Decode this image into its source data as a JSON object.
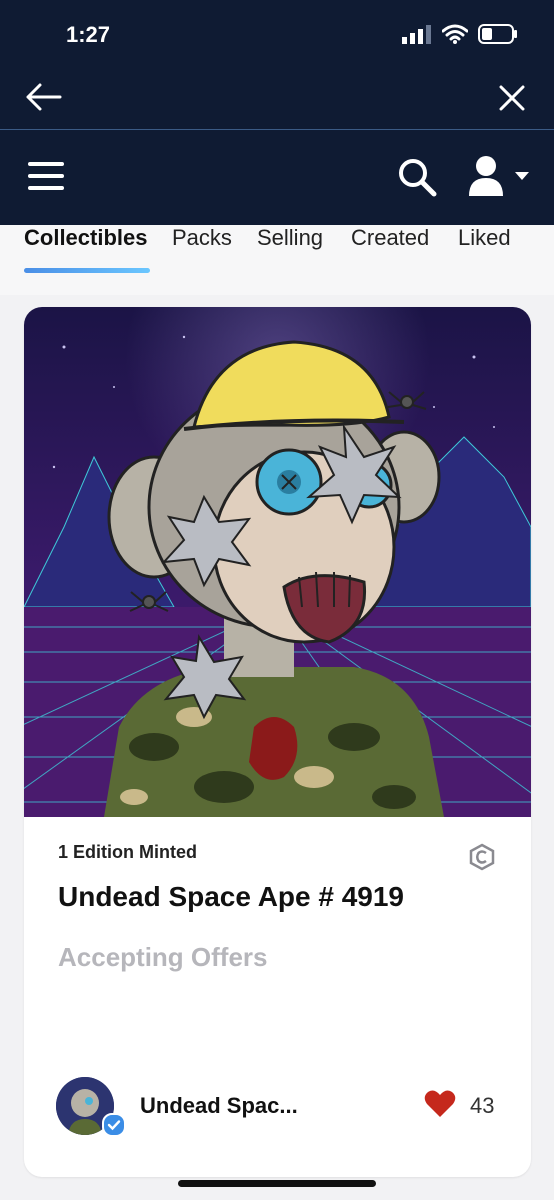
{
  "status": {
    "time": "1:27"
  },
  "tabs": [
    "Collectibles",
    "Packs",
    "Selling",
    "Created",
    "Liked"
  ],
  "card": {
    "edition_text": "1 Edition Minted",
    "title": "Undead Space Ape # 4919",
    "status_text": "Accepting Offers",
    "creator_name": "Undead Spac...",
    "likes_count": "43"
  },
  "icons": [
    "back-arrow-icon",
    "close-icon",
    "menu-icon",
    "search-icon",
    "user-icon",
    "chevron-down-icon",
    "copyright-badge-icon",
    "heart-icon",
    "verified-icon"
  ],
  "colors": {
    "header_bg": "#0f1b33",
    "tab_underline": "#4a8ee6",
    "heart": "#c5281c",
    "muted_text": "#b6b6bb"
  }
}
